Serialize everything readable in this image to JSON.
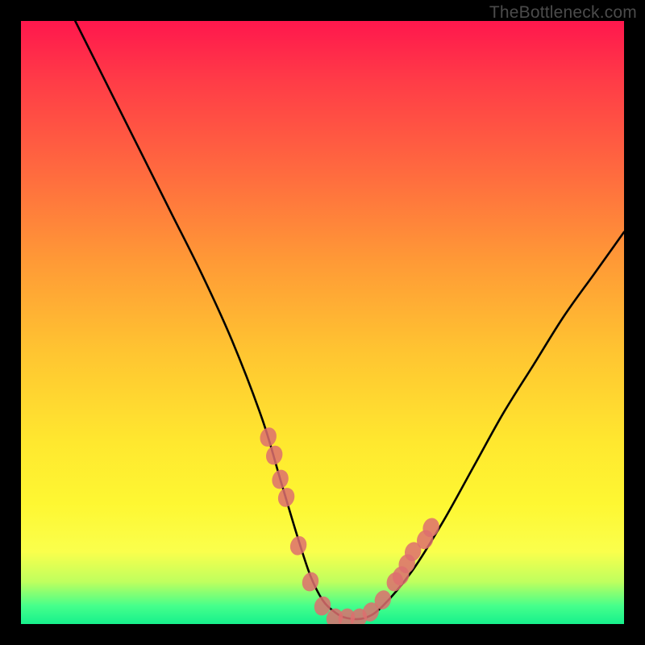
{
  "watermark": "TheBottleneck.com",
  "chart_data": {
    "type": "line",
    "title": "",
    "xlabel": "",
    "ylabel": "",
    "xlim": [
      0,
      100
    ],
    "ylim": [
      0,
      100
    ],
    "series": [
      {
        "name": "curve",
        "x": [
          9,
          15,
          20,
          25,
          30,
          35,
          40,
          43,
          46,
          48,
          50,
          52,
          54,
          57,
          60,
          65,
          70,
          75,
          80,
          85,
          90,
          95,
          100
        ],
        "values": [
          100,
          88,
          78,
          68,
          58,
          47,
          34,
          24,
          14,
          8,
          4,
          2,
          1,
          1,
          3,
          9,
          17,
          26,
          35,
          43,
          51,
          58,
          65
        ]
      }
    ],
    "markers": {
      "name": "dots",
      "x": [
        41,
        42,
        43,
        44,
        46,
        48,
        50,
        52,
        54,
        56,
        58,
        60,
        62,
        63,
        64,
        65,
        67,
        68
      ],
      "values": [
        31,
        28,
        24,
        21,
        13,
        7,
        3,
        1,
        1,
        1,
        2,
        4,
        7,
        8,
        10,
        12,
        14,
        16
      ]
    },
    "gradient_stops": [
      {
        "pos": 0,
        "color": "#ff174d"
      },
      {
        "pos": 25,
        "color": "#ff6a3f"
      },
      {
        "pos": 55,
        "color": "#ffc531"
      },
      {
        "pos": 80,
        "color": "#fef732"
      },
      {
        "pos": 97,
        "color": "#45ff8b"
      },
      {
        "pos": 100,
        "color": "#17f08c"
      }
    ]
  }
}
